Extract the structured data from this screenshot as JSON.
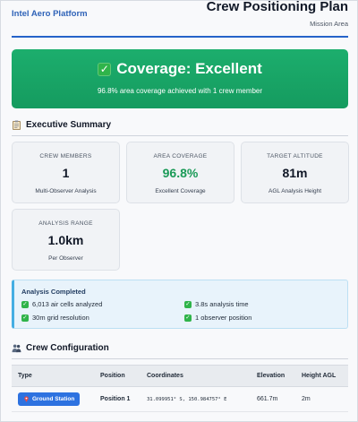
{
  "header": {
    "brand": "Intel Aero Platform",
    "title": "Crew Positioning Plan",
    "subtitle": "Mission Area"
  },
  "banner": {
    "icon": "check-mark-icon",
    "title": "Coverage: Excellent",
    "subtitle": "96.8% area coverage achieved with 1 crew member",
    "color": "#1cae6d"
  },
  "summary": {
    "title": "Executive Summary",
    "icon": "clipboard-icon",
    "cards": [
      {
        "label": "CREW MEMBERS",
        "value": "1",
        "caption": "Multi-Observer Analysis"
      },
      {
        "label": "AREA COVERAGE",
        "value": "96.8%",
        "caption": "Excellent Coverage"
      },
      {
        "label": "TARGET ALTITUDE",
        "value": "81m",
        "caption": "AGL Analysis Height"
      },
      {
        "label": "ANALYSIS RANGE",
        "value": "1.0km",
        "caption": "Per Observer"
      }
    ]
  },
  "analysis": {
    "title": "Analysis Completed",
    "items": [
      "6,013 air cells analyzed",
      "3.8s analysis time",
      "30m grid resolution",
      "1 observer position"
    ]
  },
  "crew": {
    "title": "Crew Configuration",
    "icon": "people-icon",
    "columns": [
      "Type",
      "Position",
      "Coordinates",
      "Elevation",
      "Height AGL"
    ],
    "rows": [
      {
        "type": "Ground Station",
        "position": "Position 1",
        "coordinates": "31.099951° S, 150.984757° E",
        "elevation": "661.7m",
        "height_agl": "2m"
      }
    ]
  }
}
